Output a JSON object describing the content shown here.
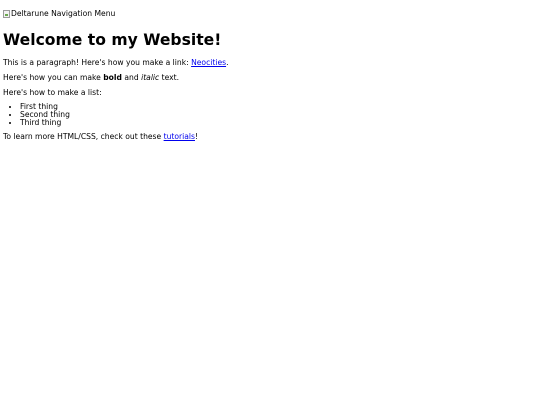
{
  "header_image": {
    "alt": "Deltarune Navigation Menu"
  },
  "heading": "Welcome to my Website!",
  "paragraph1": {
    "before": "This is a paragraph! Here's how you make a link: ",
    "link": "Neocities",
    "after": "."
  },
  "paragraph2": {
    "before": "Here's how you can make ",
    "bold": "bold",
    "middle": " and ",
    "italic": "italic",
    "after": " text."
  },
  "paragraph3": "Here's how to make a list:",
  "list": [
    "First thing",
    "Second thing",
    "Third thing"
  ],
  "paragraph4": {
    "before": "To learn more HTML/CSS, check out these ",
    "link": "tutorials",
    "after": "!"
  }
}
